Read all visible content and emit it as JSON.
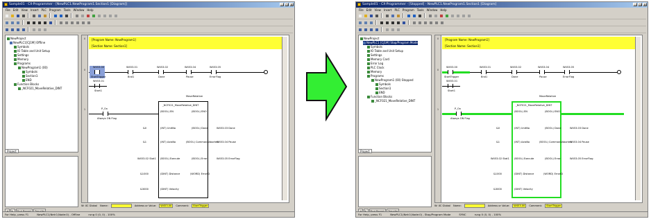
{
  "before": {
    "title": "Sample01 - CX-Programmer - [NewPLC1.NewProgram1.Section1 [Diagram]]",
    "menu": [
      "File",
      "Edit",
      "View",
      "Insert",
      "PLC",
      "Program",
      "Tools",
      "Window",
      "Help"
    ],
    "tree": [
      {
        "label": "NewProject",
        "indent": 0
      },
      {
        "label": "NewPLC1[CJ1M] Offline",
        "indent": 1
      },
      {
        "label": "Symbols",
        "indent": 2
      },
      {
        "label": "IO Table and Unit Setup",
        "indent": 2
      },
      {
        "label": "Settings",
        "indent": 2
      },
      {
        "label": "Memory",
        "indent": 2
      },
      {
        "label": "Programs",
        "indent": 2
      },
      {
        "label": "NewProgram1 (00)",
        "indent": 3
      },
      {
        "label": "Symbols",
        "indent": 4
      },
      {
        "label": "Section1",
        "indent": 4
      },
      {
        "label": "END",
        "indent": 4
      },
      {
        "label": "Function Blocks",
        "indent": 2
      },
      {
        "label": "_NCF021_MoveRelative_DINT",
        "indent": 3
      }
    ],
    "project_tab": "Project",
    "program_name": "[Program Name: NewProgram1]",
    "section_name": "[Section Name: Section1]",
    "rung_numbers": [
      "0",
      "0",
      "1"
    ],
    "contacts_top": [
      {
        "addr": "W453.00",
        "name": "StartTrigger"
      },
      {
        "addr": "W453.01",
        "name": "Bnd1"
      },
      {
        "addr": "W453.02",
        "name": "Done"
      },
      {
        "addr": "W453.04",
        "name": "Pause"
      },
      {
        "addr": "W453.05",
        "name": "ErrorFlag"
      }
    ],
    "contact_second": {
      "addr": "W453.01",
      "name": "Start1"
    },
    "fb": {
      "instance": "MoveRelative",
      "name": "_NCF021_MoveRelative_DINT",
      "left_pins": [
        "(BOOL) EN",
        "(INT) UnitNo",
        "(INT) AxisNo",
        "(BOOL) Execute",
        "(DINT) Distance",
        "(DINT) Velocity"
      ],
      "right_pins": [
        "(BOOL) ENO",
        "(BOOL) Done",
        "(BOOL) CommandAborted",
        "(BOOL) Error",
        "(WORD) ErrorID"
      ],
      "left_inputs": [
        "&0",
        "&1",
        "W453.02 Stat1",
        "&1000",
        "&3000"
      ],
      "right_outputs": [
        "W453.03 Done",
        "W453.04 Pause",
        "W453.05 ErrorFlag"
      ]
    },
    "p_on": "P_On",
    "p_on_comment": "Always ON Flag",
    "status_fields": [
      "W: XC Global",
      "Name:",
      "Address or Value:",
      "W453.00",
      "Comment:",
      "StartTrigger"
    ],
    "statusbar": [
      "For Help, press F1",
      "NewPLC1(Net:0,Node:0) - Offline",
      "rung 0 (0, 0) - 100%"
    ]
  },
  "after": {
    "title": "Sample01 - CX-Programmer - [Stopped] - NewPLC1.NewProgram1.Section1 [Diagram]",
    "menu": [
      "File",
      "Edit",
      "View",
      "Insert",
      "PLC",
      "Program",
      "Tools",
      "Window",
      "Help"
    ],
    "tree": [
      {
        "label": "NewProject",
        "indent": 0
      },
      {
        "label": "NewPLC1 [CJ1M] Stop/Program Mode",
        "indent": 1
      },
      {
        "label": "Symbols",
        "indent": 2
      },
      {
        "label": "IO Table and Unit Setup",
        "indent": 2
      },
      {
        "label": "Settings",
        "indent": 2
      },
      {
        "label": "Memory Card",
        "indent": 2
      },
      {
        "label": "Error Log",
        "indent": 2
      },
      {
        "label": "PLC Clock",
        "indent": 2
      },
      {
        "label": "Memory",
        "indent": 2
      },
      {
        "label": "Programs",
        "indent": 2
      },
      {
        "label": "NewProgram1 (00) Stopped",
        "indent": 3
      },
      {
        "label": "Symbols",
        "indent": 4
      },
      {
        "label": "Section1",
        "indent": 4
      },
      {
        "label": "END",
        "indent": 4
      },
      {
        "label": "Function Blocks",
        "indent": 2
      },
      {
        "label": "_NCF021_MoveRelative_DINT",
        "indent": 3
      }
    ],
    "project_tab": "Project",
    "program_name": "[Program Name: NewProgram1]",
    "section_name": "[Section Name: Section1]",
    "statusbar": [
      "For Help, press F1",
      "NewPLC1(Net:0,Node:0) - Stop/Program Mode",
      "SYNC",
      "rung 0 (0, 0) - 100%"
    ],
    "status_fields": [
      "W: XC Global",
      "Name:",
      "Address or Value:",
      "W453.00",
      "Comment:",
      "StartTrigger"
    ]
  }
}
